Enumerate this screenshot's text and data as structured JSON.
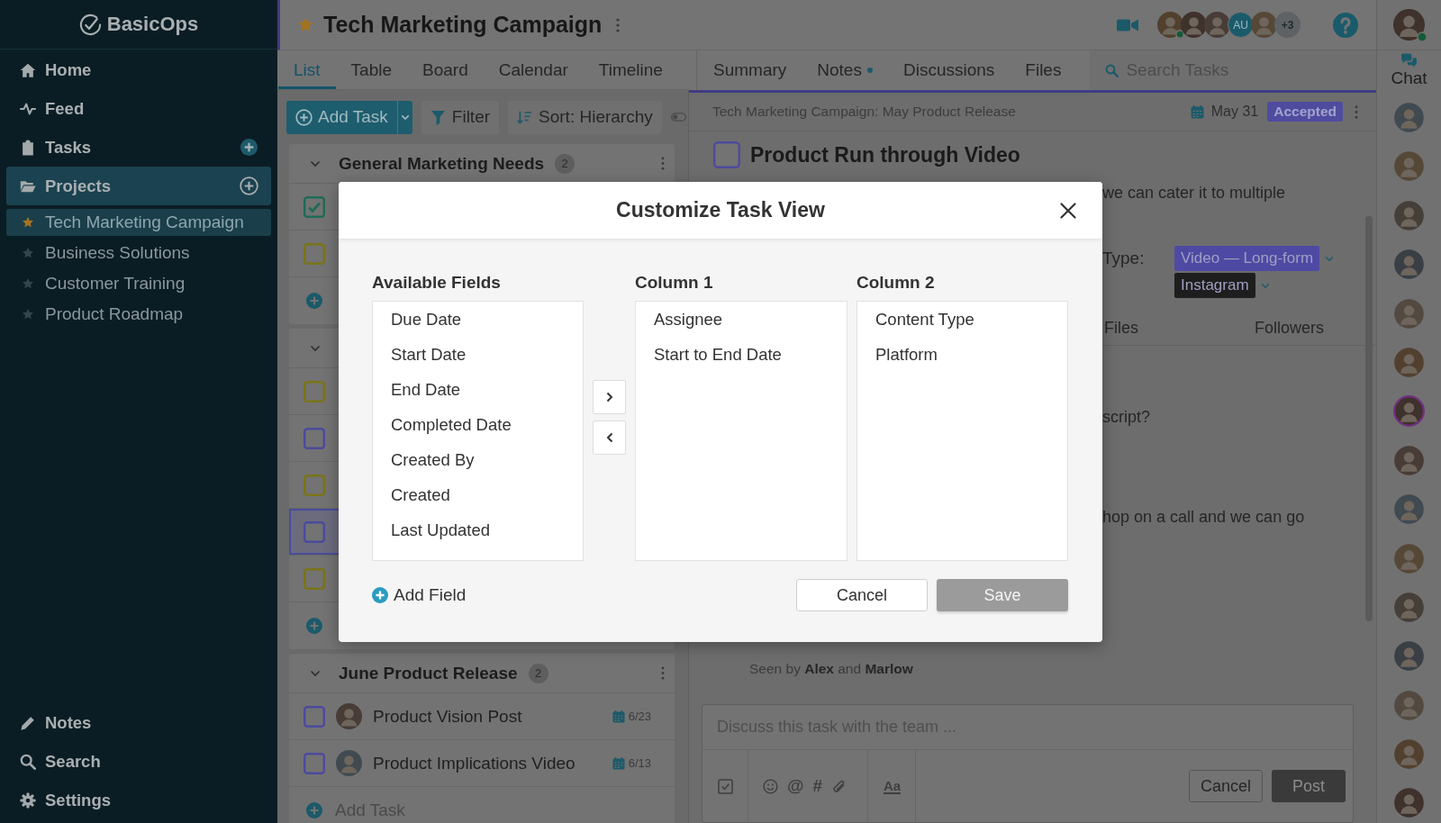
{
  "sidebar": {
    "logo": "BasicOps",
    "nav": [
      {
        "label": "Home",
        "selected": false,
        "add_button": false
      },
      {
        "label": "Feed",
        "selected": false,
        "add_button": false
      },
      {
        "label": "Tasks",
        "selected": false,
        "add_button": true
      },
      {
        "label": "Projects",
        "selected": true,
        "add_button": true
      }
    ],
    "projects": [
      {
        "label": "Tech Marketing Campaign",
        "selected": true,
        "starred": true
      },
      {
        "label": "Business Solutions",
        "selected": false,
        "starred": false
      },
      {
        "label": "Customer Training",
        "selected": false,
        "starred": false
      },
      {
        "label": "Product Roadmap",
        "selected": false,
        "starred": false
      }
    ],
    "bottom_nav": [
      {
        "label": "Notes",
        "selected": false
      },
      {
        "label": "Search",
        "selected": false
      },
      {
        "label": "Settings",
        "selected": false
      }
    ]
  },
  "header": {
    "title": "Tech Marketing Campaign",
    "starred": true,
    "members": [
      {
        "kind": "photo",
        "online": true
      },
      {
        "kind": "photo",
        "online": false
      },
      {
        "kind": "photo",
        "online": false
      },
      {
        "kind": "initials",
        "label": "AU",
        "online": false
      },
      {
        "kind": "photo",
        "online": false
      },
      {
        "kind": "more",
        "label": "+3"
      }
    ]
  },
  "user": {
    "online": true
  },
  "tabs": [
    {
      "label": "List",
      "selected": true
    },
    {
      "label": "Table",
      "selected": false
    },
    {
      "label": "Board",
      "selected": false
    },
    {
      "label": "Calendar",
      "selected": false
    },
    {
      "label": "Timeline",
      "selected": false
    }
  ],
  "detail_tabs": [
    {
      "label": "Summary",
      "selected": false,
      "unread": false
    },
    {
      "label": "Notes",
      "selected": false,
      "unread": true
    },
    {
      "label": "Discussions",
      "selected": false,
      "unread": false
    },
    {
      "label": "Files",
      "selected": false,
      "unread": false
    }
  ],
  "search": {
    "placeholder": "Search Tasks"
  },
  "list_toolbar": {
    "add_task": "Add Task",
    "filter": "Filter",
    "sort": "Sort: Hierarchy"
  },
  "groups": [
    {
      "name": "General Marketing Needs",
      "count": "2",
      "expanded": true,
      "menu": true,
      "tasks": [
        {
          "checked": true,
          "color": "#1f6b58",
          "selected": false
        },
        {
          "checked": false,
          "color": "#7a7418",
          "selected": false
        }
      ],
      "add_row": true
    },
    {
      "expanded": true,
      "menu": false,
      "tasks": [
        {
          "checked": false,
          "color": "#7a7418",
          "selected": false
        },
        {
          "checked": false,
          "color": "#4b4b9e",
          "selected": false
        },
        {
          "checked": false,
          "color": "#7a7418",
          "selected": false
        },
        {
          "checked": false,
          "color": "#4b4b9e",
          "selected": true
        },
        {
          "checked": false,
          "color": "#7a7418",
          "selected": false
        }
      ],
      "add_row": true
    },
    {
      "name": "June Product Release",
      "count": "2",
      "expanded": true,
      "menu": true,
      "tasks": [
        {
          "title": "Product Vision Post",
          "due": "6/23",
          "checked": false,
          "color": "#4b4b9e",
          "selected": false
        },
        {
          "title": "Product Implications Video",
          "due": "6/13",
          "checked": false,
          "color": "#4b4b9e",
          "selected": false
        }
      ],
      "add_row": true,
      "add_label": "Add Task"
    }
  ],
  "detail": {
    "breadcrumb": "Tech Marketing Campaign: May Product Release",
    "due": "May 31",
    "status": "Accepted",
    "title": "Product Run through Video",
    "completed": false,
    "description": "we can cater it to multiple",
    "field_label": "Type:",
    "tags": [
      {
        "label": "Video — Long-form",
        "color": "#4e4aa3"
      },
      {
        "label": "Instagram",
        "color": "#1e1e1e"
      }
    ],
    "subtabs": [
      "Files",
      "Followers"
    ],
    "messages": [
      "script?",
      "hop on a call and we can go"
    ],
    "seen_by": "Seen by **Alex** and **Marlow**",
    "comment": {
      "placeholder": "Discuss this task with the team ...",
      "mention": "@",
      "hashtag": "#",
      "format": "Aa",
      "cancel": "Cancel",
      "post": "Post"
    }
  },
  "chat": {
    "label": "Chat",
    "contacts": [
      {
        "selected": false
      },
      {
        "selected": false
      },
      {
        "selected": false
      },
      {
        "selected": false
      },
      {
        "selected": false
      },
      {
        "selected": false
      },
      {
        "selected": true
      },
      {
        "selected": false
      },
      {
        "selected": false
      },
      {
        "selected": false
      },
      {
        "selected": false
      },
      {
        "selected": false
      },
      {
        "selected": false
      },
      {
        "selected": false
      },
      {
        "selected": false
      }
    ]
  },
  "modal": {
    "title": "Customize Task View",
    "columns": [
      {
        "heading": "Available Fields",
        "items": [
          "Due Date",
          "Start Date",
          "End Date",
          "Completed Date",
          "Created By",
          "Created",
          "Last Updated"
        ]
      },
      {
        "heading": "Column 1",
        "items": [
          "Assignee",
          "Start to End Date"
        ]
      },
      {
        "heading": "Column 2",
        "items": [
          "Content Type",
          "Platform"
        ]
      }
    ],
    "add_field": "Add Field",
    "cancel": "Cancel",
    "save": {
      "label": "Save",
      "disabled": true
    }
  }
}
